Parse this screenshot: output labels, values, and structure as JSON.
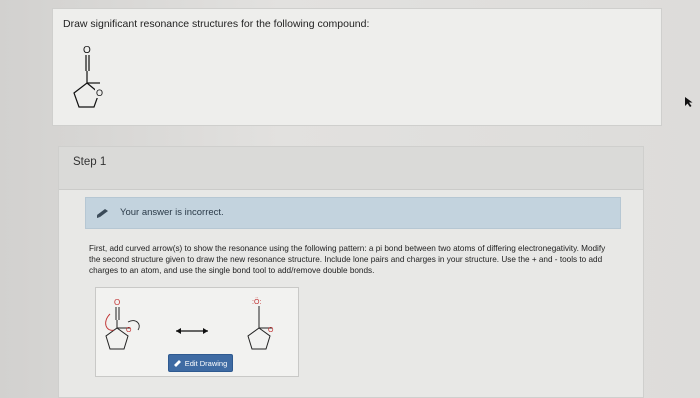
{
  "question": {
    "text": "Draw significant resonance structures for the following compound:",
    "molecule_labels": {
      "carbonyl_o": "O",
      "ring_o": "O"
    }
  },
  "step": {
    "label": "Step 1",
    "alert": "Your answer is incorrect.",
    "instructions": "First, add curved arrow(s) to show the resonance using the following pattern: a pi bond between two atoms of differing electronegativity. Modify the second structure given to draw the new resonance structure. Include lone pairs and charges in your structure. Use the + and - tools to add charges to an atom, and use the single bond tool to add/remove double bonds.",
    "edit_button": "Edit Drawing"
  },
  "drawing": {
    "left_o": "O",
    "left_ring_o": "O",
    "right_o": ":Ö:",
    "right_ring_o": "O"
  },
  "colors": {
    "alert_bg": "#c3d3de",
    "button_bg": "#3f6ba3"
  }
}
